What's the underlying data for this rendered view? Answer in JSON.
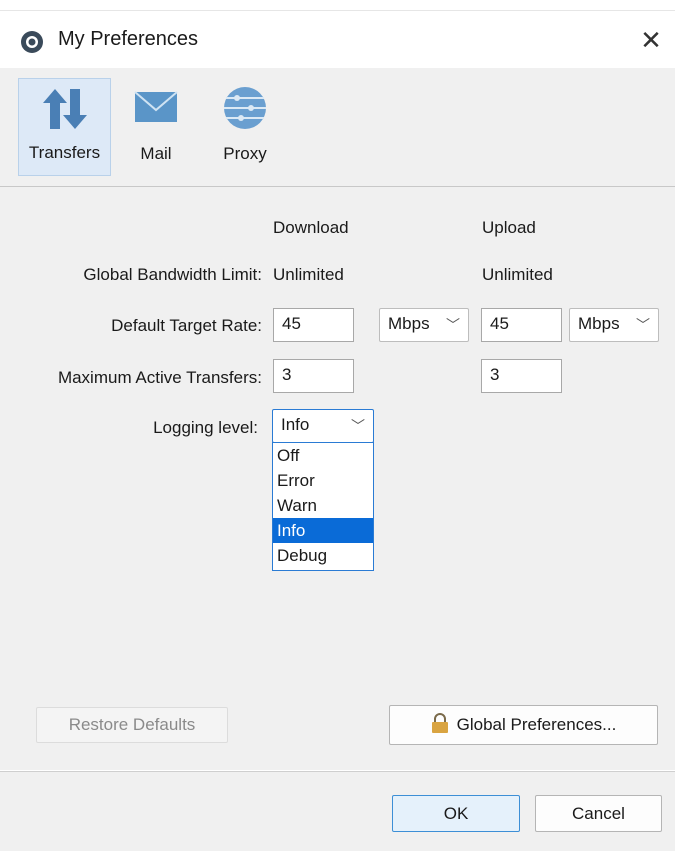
{
  "window": {
    "title": "My Preferences",
    "close": "✕"
  },
  "toolbar": {
    "items": [
      {
        "label": "Transfers",
        "icon": "transfers-arrows-icon",
        "active": true
      },
      {
        "label": "Mail",
        "icon": "mail-envelope-icon",
        "active": false
      },
      {
        "label": "Proxy",
        "icon": "proxy-globe-icon",
        "active": false
      }
    ]
  },
  "form": {
    "col_download": "Download",
    "col_upload": "Upload",
    "bandwidth_label": "Global Bandwidth Limit:",
    "bandwidth_download": "Unlimited",
    "bandwidth_upload": "Unlimited",
    "target_rate_label": "Default Target Rate:",
    "target_rate_download": "45",
    "target_rate_download_unit": "Mbps",
    "target_rate_upload": "45",
    "target_rate_upload_unit": "Mbps",
    "max_active_label": "Maximum Active Transfers:",
    "max_active_download": "3",
    "max_active_upload": "3",
    "logging_label": "Logging level:",
    "logging_value": "Info",
    "logging_options": [
      "Off",
      "Error",
      "Warn",
      "Info",
      "Debug"
    ]
  },
  "buttons": {
    "restore": "Restore Defaults",
    "global": "Global Preferences...",
    "ok": "OK",
    "cancel": "Cancel"
  },
  "colors": {
    "selection": "#0a6bd7",
    "focus_border": "#2a7bd4",
    "panel_bg": "#f0f0f0"
  }
}
